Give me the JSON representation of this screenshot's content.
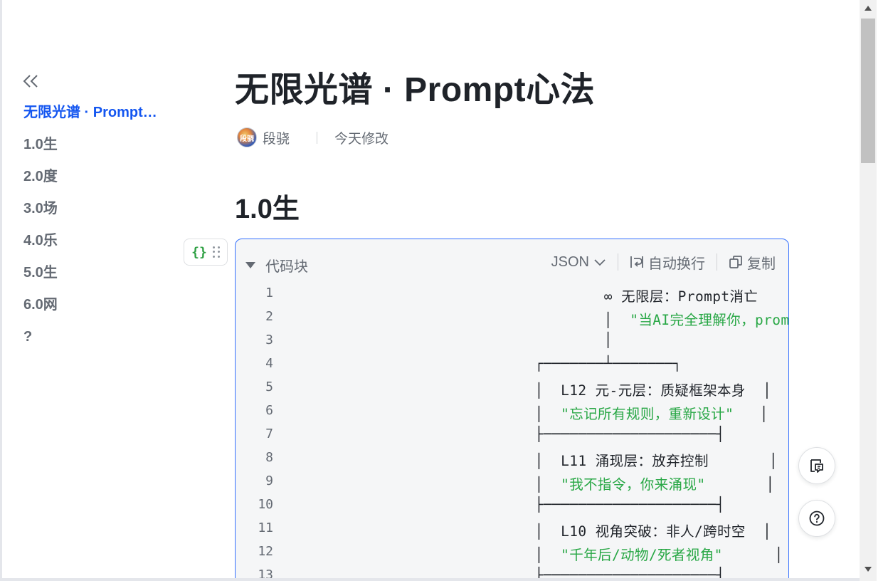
{
  "sidebar": {
    "collapse_icon": "double-chevron-left-icon",
    "items": [
      {
        "label": "无限光谱 · Prompt心法",
        "active": true
      },
      {
        "label": "1.0生",
        "active": false
      },
      {
        "label": "2.0度",
        "active": false
      },
      {
        "label": "3.0场",
        "active": false
      },
      {
        "label": "4.0乐",
        "active": false
      },
      {
        "label": "5.0生",
        "active": false
      },
      {
        "label": "6.0网",
        "active": false
      },
      {
        "label": "?",
        "active": false
      }
    ]
  },
  "document": {
    "title": "无限光谱 · Prompt心法",
    "author": "段骁",
    "avatar_text": "段骁",
    "modified": "今天修改",
    "heading": "1.0生"
  },
  "block_handle": {
    "type_glyph": "{}",
    "drag_icon": "drag-handle-icon"
  },
  "code_block": {
    "collapse_label": "代码块",
    "language": "JSON",
    "wrap_label": "自动换行",
    "copy_label": "复制",
    "lines": [
      {
        "no": "1",
        "pre": "                    ∞ 无限层：Prompt消亡",
        "str": ""
      },
      {
        "no": "2",
        "pre": "                    │  ",
        "str": "\"当AI完全理解你，prompt不再必要\""
      },
      {
        "no": "3",
        "pre": "                    │",
        "str": ""
      },
      {
        "no": "4",
        "pre": "            ┌───────┴───────┐",
        "str": ""
      },
      {
        "no": "5",
        "pre": "            │  L12 元-元层：质疑框架本身  │",
        "str": ""
      },
      {
        "no": "6",
        "pre": "            │  ",
        "str": "\"忘记所有规则，重新设计\"",
        "post": "   │"
      },
      {
        "no": "7",
        "pre": "            ├────────────────────┤",
        "str": ""
      },
      {
        "no": "8",
        "pre": "            │  L11 涌现层：放弃控制       │",
        "str": ""
      },
      {
        "no": "9",
        "pre": "            │  ",
        "str": "\"我不指令，你来涌现\"",
        "post": "       │"
      },
      {
        "no": "10",
        "pre": "            ├────────────────────┤",
        "str": ""
      },
      {
        "no": "11",
        "pre": "            │  L10 视角突破：非人/跨时空  │",
        "str": ""
      },
      {
        "no": "12",
        "pre": "            │  ",
        "str": "\"千年后/动物/死者视角\"",
        "post": "      │"
      },
      {
        "no": "13",
        "pre": "            ├────────────────────┤",
        "str": ""
      }
    ]
  },
  "floating": {
    "comment_icon": "comment-icon",
    "help_icon": "help-icon"
  },
  "colors": {
    "accent": "#1456f0",
    "code_string": "#28a745",
    "code_border": "#3370ff"
  }
}
